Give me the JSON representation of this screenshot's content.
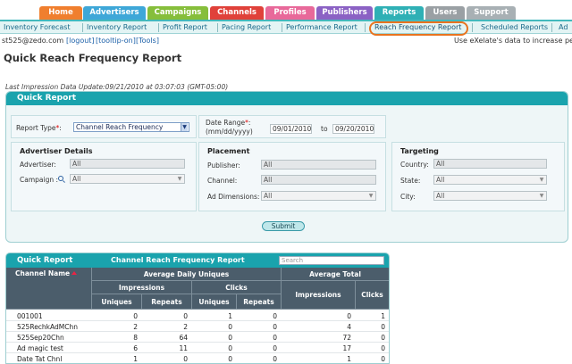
{
  "top_tabs": [
    {
      "label": "Home",
      "color": "#f07f2e"
    },
    {
      "label": "Advertisers",
      "color": "#3ea7d8"
    },
    {
      "label": "Campaigns",
      "color": "#86be3b"
    },
    {
      "label": "Channels",
      "color": "#e0413a"
    },
    {
      "label": "Profiles",
      "color": "#e8699a"
    },
    {
      "label": "Publishers",
      "color": "#8b62c4"
    },
    {
      "label": "Reports",
      "color": "#2fb0b5"
    },
    {
      "label": "Users",
      "color": "#9aa0a4"
    },
    {
      "label": "Support",
      "color": "#a8b0b4"
    }
  ],
  "subnav": {
    "items": [
      "Inventory Forecast",
      "Inventory Report",
      "Profit Report",
      "Pacing Report",
      "Performance Report",
      "Reach Frequency Report",
      "Scheduled Reports",
      "Ad"
    ],
    "active": "Reach Frequency Report",
    "active_color": "#e8731f"
  },
  "userline": {
    "email": "st525@zedo.com",
    "links": [
      "[logout]",
      "[tooltip-on]",
      "[Tools]"
    ],
    "message": "Use eXelate's data to increase perf"
  },
  "page_title": "Quick Reach Frequency Report",
  "last_update": "Last Impression Data Update:09/21/2010 at 03:07:03 (GMT-05:00)",
  "form": {
    "panel_title": "Quick Report",
    "report_type_label": "Report Type",
    "report_type_value": "Channel Reach Frequency",
    "date_range_label": "Date Range",
    "date_format": "(mm/dd/yyyy)",
    "date_from": "09/01/2010",
    "date_to_label": "to",
    "date_to": "09/20/2010",
    "advertiser_title": "Advertiser Details",
    "advertiser_label": "Advertiser:",
    "advertiser_value": "All",
    "campaign_label": "Campaign :",
    "campaign_value": "All",
    "placement_title": "Placement",
    "publisher_label": "Publisher:",
    "publisher_value": "All",
    "channel_label": "Channel:",
    "channel_value": "All",
    "ad_dim_label": "Ad Dimensions:",
    "ad_dim_value": "All",
    "targeting_title": "Targeting",
    "country_label": "Country:",
    "country_value": "All",
    "state_label": "State:",
    "state_value": "All",
    "city_label": "City:",
    "city_value": "All",
    "submit_label": "Submit",
    "required_mark": "*",
    "colon": ":"
  },
  "results": {
    "title": "Quick Report",
    "subtitle": "Channel Reach Frequency Report",
    "search_placeholder": "Search",
    "col_channel": "Channel Name",
    "group_daily": "Average Daily Uniques",
    "group_total": "Average Total",
    "sub_impressions": "Impressions",
    "sub_clicks": "Clicks",
    "col_uniques": "Uniques",
    "col_repeats": "Repeats",
    "col_impressions": "Impressions",
    "col_clicks": "Clicks",
    "rows": [
      {
        "name": "001001",
        "v": [
          "0",
          "0",
          "1",
          "0",
          "0",
          "1"
        ]
      },
      {
        "name": "525RechkAdMChn",
        "v": [
          "2",
          "2",
          "0",
          "0",
          "4",
          "0"
        ]
      },
      {
        "name": "525Sep20Chn",
        "v": [
          "8",
          "64",
          "0",
          "0",
          "72",
          "0"
        ]
      },
      {
        "name": "Ad magic test",
        "v": [
          "6",
          "11",
          "0",
          "0",
          "17",
          "0"
        ]
      },
      {
        "name": "Date Tat Chnl",
        "v": [
          "1",
          "0",
          "0",
          "0",
          "1",
          "0"
        ]
      }
    ]
  }
}
